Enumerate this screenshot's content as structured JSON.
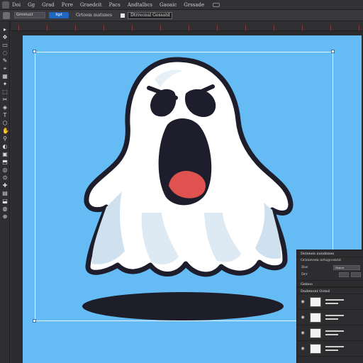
{
  "menubar": {
    "items": [
      "Doi",
      "Gg",
      "Grad",
      "Pcre",
      "Graedcit",
      "Pacs",
      "Andtalbcs",
      "Gaoaic",
      "Grssade"
    ]
  },
  "options": {
    "field_value": "Grmmuct",
    "button_label": "Iigd",
    "label": "Grtoom matunes",
    "dropdown_label": "Dtrrecnal Gossatd"
  },
  "tools": [
    "▸",
    "✥",
    "▭",
    "◌",
    "✎",
    "⌖",
    "▦",
    "✦",
    "⬚",
    "✂",
    "◈",
    "T",
    "⬡",
    "✋",
    "⚲",
    "◐",
    "▣",
    "⬒",
    "◎",
    "⊙",
    "✚",
    "▤",
    "⬓",
    "◍",
    "⊕"
  ],
  "panel": {
    "title": "Dstenen aundnnes",
    "subtitle": "Grioisvem urtagcomtd",
    "rows": [
      {
        "label": "Ibw",
        "value": "Grace"
      },
      {
        "label": "Drr",
        "value": ""
      }
    ],
    "section_1": "Gsmso",
    "section_2": "Dadenont Gvmd",
    "layers": [
      {
        "icon": "◉"
      },
      {
        "icon": "◉"
      },
      {
        "icon": "◉"
      },
      {
        "icon": "◉"
      }
    ]
  },
  "colors": {
    "artboard": "#65bbf3",
    "ghost_body": "#ffffff",
    "ghost_shade": "#cfe0ee",
    "outline": "#1d1d2b",
    "mouth_tongue": "#e0524f",
    "shadow": "#1e1e2a",
    "accent_button": "#1f66c0"
  }
}
